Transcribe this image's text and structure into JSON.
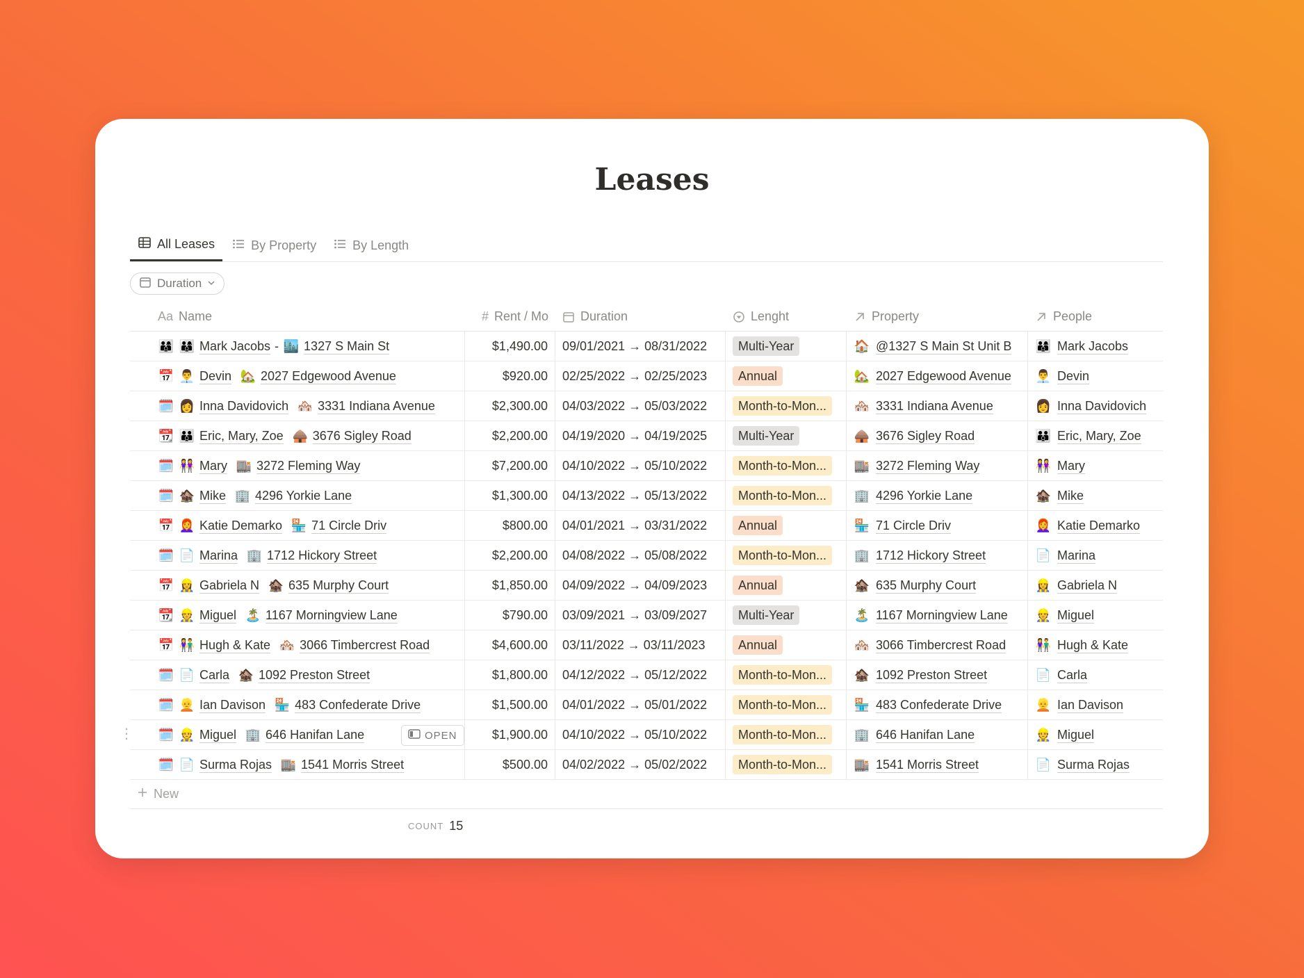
{
  "page": {
    "title": "Leases"
  },
  "tabs": [
    {
      "label": "All Leases",
      "icon": "table-icon",
      "active": true
    },
    {
      "label": "By Property",
      "icon": "list-icon",
      "active": false
    },
    {
      "label": "By Length",
      "icon": "list-icon",
      "active": false
    }
  ],
  "filter": {
    "label": "Duration"
  },
  "columns": {
    "name": "Name",
    "name_icon": "Aa",
    "rent": "Rent / Mo",
    "rent_icon": "#",
    "duration": "Duration",
    "length": "Lenght",
    "property": "Property",
    "people": "People"
  },
  "colors": {
    "tag_gray": "#e3e2e0",
    "tag_orange": "#fadec9",
    "tag_yellow": "#fdecc8"
  },
  "rows": [
    {
      "icon": "👨‍👩‍👦",
      "person_icon": "👨‍👩‍👦",
      "person": "Mark Jacobs",
      "sep": " - ",
      "prop_icon": "🏙️",
      "prop": "1327 S Main St",
      "rent": "$1,490.00",
      "duration": "09/01/2021 → 08/31/2022",
      "length": "Multi-Year",
      "tag": "gray",
      "property_icon": "🏠",
      "property": "@1327 S Main St Unit B",
      "people_icon": "👨‍👩‍👦",
      "people": "Mark Jacobs"
    },
    {
      "icon": "📅",
      "person_icon": "👨‍💼",
      "person": "Devin",
      "sep": "",
      "prop_icon": "🏡",
      "prop": "2027 Edgewood Avenue",
      "rent": "$920.00",
      "duration": "02/25/2022 → 02/25/2023",
      "length": "Annual",
      "tag": "orange",
      "property_icon": "🏡",
      "property": "2027 Edgewood Avenue",
      "people_icon": "👨‍💼",
      "people": "Devin"
    },
    {
      "icon": "🗓️",
      "person_icon": "👩",
      "person": "Inna Davidovich",
      "sep": "",
      "prop_icon": "🏘️",
      "prop": "3331 Indiana Avenue",
      "rent": "$2,300.00",
      "duration": "04/03/2022 → 05/03/2022",
      "length": "Month-to-Mon...",
      "tag": "yellow",
      "property_icon": "🏘️",
      "property": "3331 Indiana Avenue",
      "people_icon": "👩",
      "people": "Inna Davidovich"
    },
    {
      "icon": "📆",
      "person_icon": "👪",
      "person": "Eric, Mary, Zoe",
      "sep": "",
      "prop_icon": "🛖",
      "prop": "3676 Sigley Road",
      "rent": "$2,200.00",
      "duration": "04/19/2020 → 04/19/2025",
      "length": "Multi-Year",
      "tag": "gray",
      "property_icon": "🛖",
      "property": "3676 Sigley Road",
      "people_icon": "👪",
      "people": "Eric, Mary, Zoe"
    },
    {
      "icon": "🗓️",
      "person_icon": "👭",
      "person": "Mary",
      "sep": "",
      "prop_icon": "🏬",
      "prop": "3272 Fleming Way",
      "rent": "$7,200.00",
      "duration": "04/10/2022 → 05/10/2022",
      "length": "Month-to-Mon...",
      "tag": "yellow",
      "property_icon": "🏬",
      "property": "3272 Fleming Way",
      "people_icon": "👭",
      "people": "Mary"
    },
    {
      "icon": "🗓️",
      "person_icon": "🏚️",
      "person": "Mike",
      "sep": "",
      "prop_icon": "🏢",
      "prop": "4296 Yorkie Lane",
      "rent": "$1,300.00",
      "duration": "04/13/2022 → 05/13/2022",
      "length": "Month-to-Mon...",
      "tag": "yellow",
      "property_icon": "🏢",
      "property": "4296 Yorkie Lane",
      "people_icon": "🏚️",
      "people": "Mike"
    },
    {
      "icon": "📅",
      "person_icon": "👩‍🦰",
      "person": "Katie Demarko",
      "sep": "",
      "prop_icon": "🏪",
      "prop": "71 Circle Driv",
      "rent": "$800.00",
      "duration": "04/01/2021 → 03/31/2022",
      "length": "Annual",
      "tag": "orange",
      "property_icon": "🏪",
      "property": "71 Circle Driv",
      "people_icon": "👩‍🦰",
      "people": "Katie Demarko"
    },
    {
      "icon": "🗓️",
      "person_icon": "📄",
      "person": "Marina",
      "sep": "",
      "prop_icon": "🏢",
      "prop": "1712 Hickory Street",
      "rent": "$2,200.00",
      "duration": "04/08/2022 → 05/08/2022",
      "length": "Month-to-Mon...",
      "tag": "yellow",
      "property_icon": "🏢",
      "property": "1712 Hickory Street",
      "people_icon": "📄",
      "people": "Marina"
    },
    {
      "icon": "📅",
      "person_icon": "👷‍♀️",
      "person": "Gabriela N",
      "sep": "",
      "prop_icon": "🏚️",
      "prop": "635 Murphy Court",
      "rent": "$1,850.00",
      "duration": "04/09/2022 → 04/09/2023",
      "length": "Annual",
      "tag": "orange",
      "property_icon": "🏚️",
      "property": "635 Murphy Court",
      "people_icon": "👷‍♀️",
      "people": "Gabriela N"
    },
    {
      "icon": "📆",
      "person_icon": "👷",
      "person": "Miguel",
      "sep": "",
      "prop_icon": "🏝️",
      "prop": "1167 Morningview Lane",
      "rent": "$790.00",
      "duration": "03/09/2021 → 03/09/2027",
      "length": "Multi-Year",
      "tag": "gray",
      "property_icon": "🏝️",
      "property": "1167 Morningview Lane",
      "people_icon": "👷",
      "people": "Miguel"
    },
    {
      "icon": "📅",
      "person_icon": "👫",
      "person": "Hugh & Kate",
      "sep": "",
      "prop_icon": "🏘️",
      "prop": "3066 Timbercrest Road",
      "rent": "$4,600.00",
      "duration": "03/11/2022 → 03/11/2023",
      "length": "Annual",
      "tag": "orange",
      "property_icon": "🏘️",
      "property": "3066 Timbercrest Road",
      "people_icon": "👫",
      "people": "Hugh & Kate"
    },
    {
      "icon": "🗓️",
      "person_icon": "📄",
      "person": "Carla",
      "sep": "",
      "prop_icon": "🏚️",
      "prop": "1092 Preston Street",
      "rent": "$1,800.00",
      "duration": "04/12/2022 → 05/12/2022",
      "length": "Month-to-Mon...",
      "tag": "yellow",
      "property_icon": "🏚️",
      "property": "1092 Preston Street",
      "people_icon": "📄",
      "people": "Carla"
    },
    {
      "icon": "🗓️",
      "person_icon": "👱",
      "person": "Ian Davison",
      "sep": "",
      "prop_icon": "🏪",
      "prop": "483 Confederate Drive",
      "rent": "$1,500.00",
      "duration": "04/01/2022 → 05/01/2022",
      "length": "Month-to-Mon...",
      "tag": "yellow",
      "property_icon": "🏪",
      "property": "483 Confederate Drive",
      "people_icon": "👱",
      "people": "Ian Davison"
    },
    {
      "icon": "🗓️",
      "person_icon": "👷",
      "person": "Miguel",
      "sep": "",
      "prop_icon": "🏢",
      "prop": "646 Hanifan Lane",
      "rent": "$1,900.00",
      "duration": "04/10/2022 → 05/10/2022",
      "length": "Month-to-Mon...",
      "tag": "yellow",
      "property_icon": "🏢",
      "property": "646 Hanifan Lane",
      "people_icon": "👷",
      "people": "Miguel",
      "hover": true
    },
    {
      "icon": "🗓️",
      "person_icon": "📄",
      "person": "Surma Rojas",
      "sep": "",
      "prop_icon": "🏬",
      "prop": "1541 Morris Street",
      "rent": "$500.00",
      "duration": "04/02/2022 → 05/02/2022",
      "length": "Month-to-Mon...",
      "tag": "yellow",
      "property_icon": "🏬",
      "property": "1541 Morris Street",
      "people_icon": "📄",
      "people": "Surma Rojas"
    }
  ],
  "open_label": "OPEN",
  "new_label": "New",
  "footer": {
    "count_label": "COUNT",
    "count_value": "15"
  }
}
